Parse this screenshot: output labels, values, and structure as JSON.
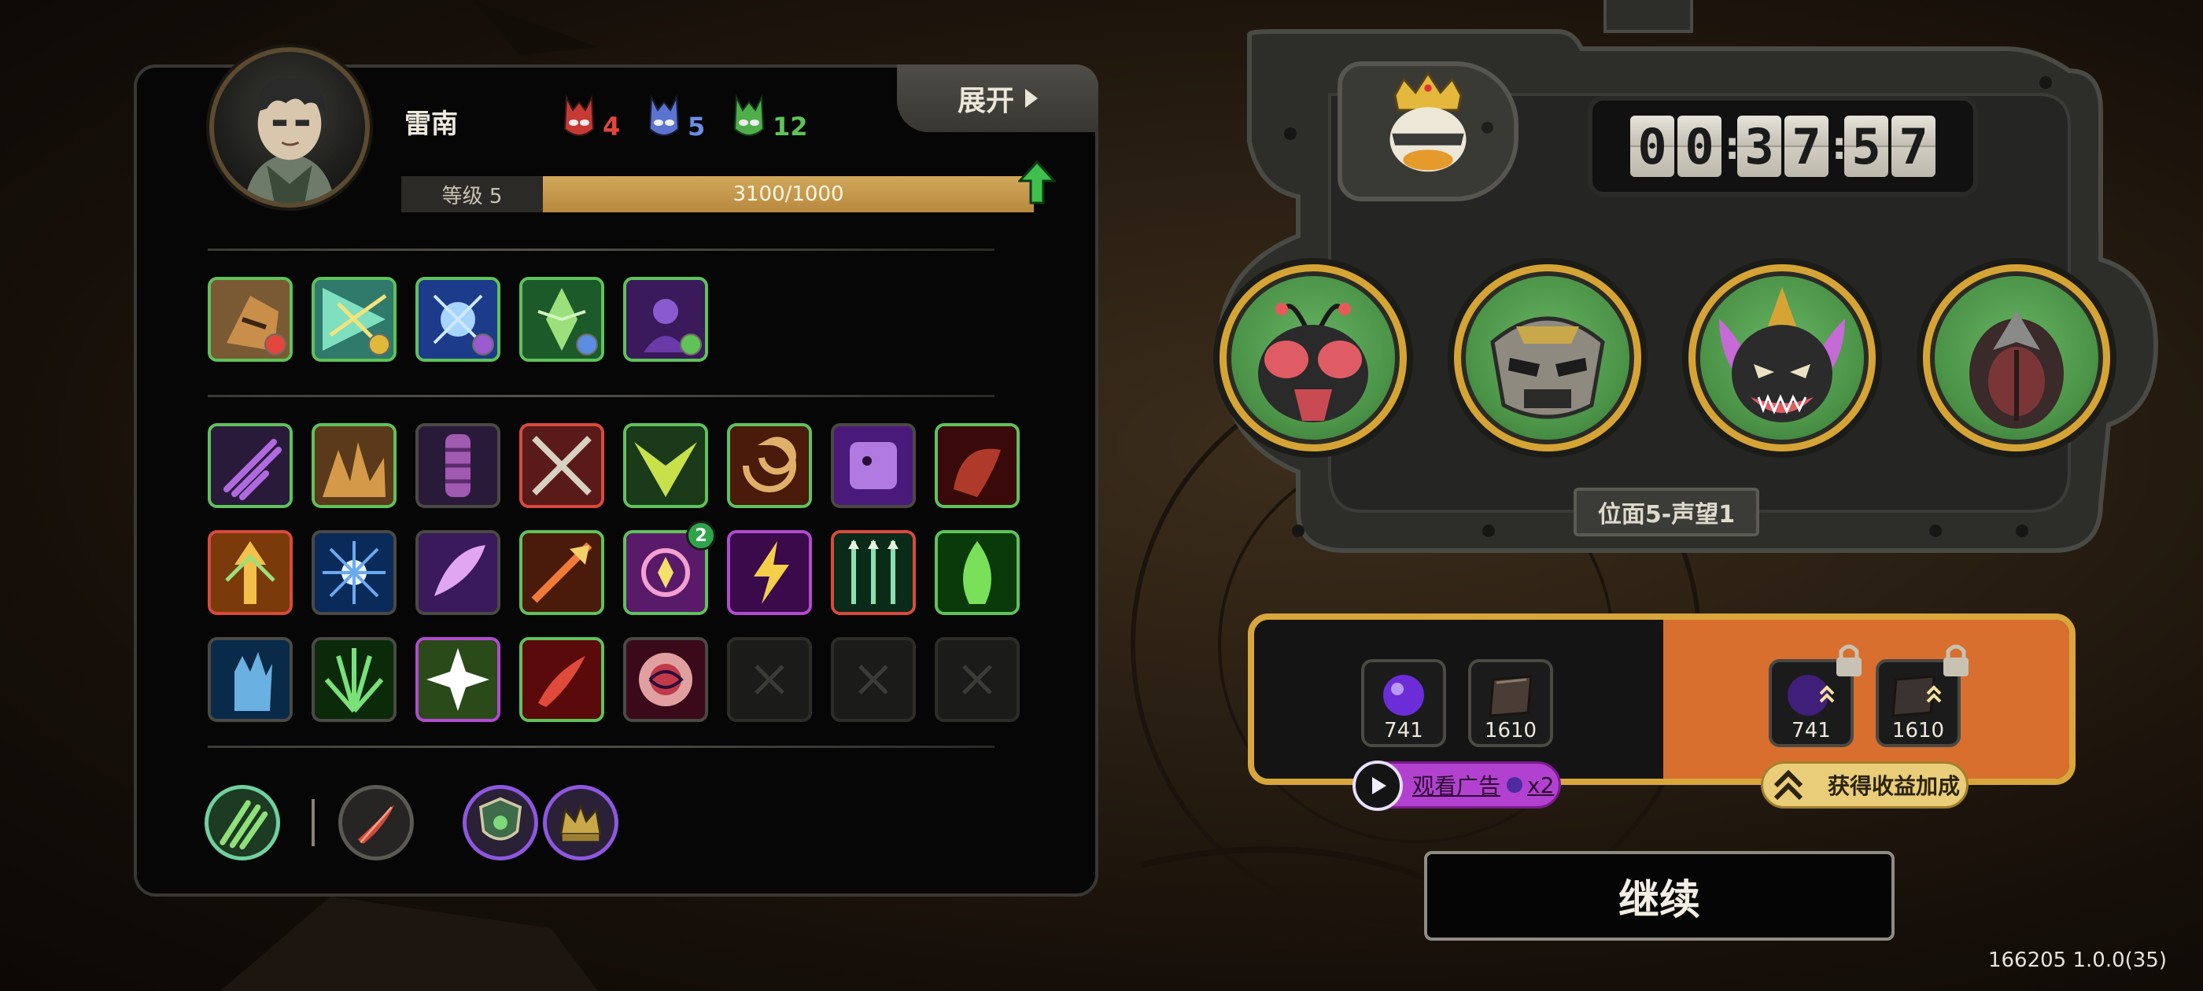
{
  "panel": {
    "expand_label": "展开",
    "character_name": "雷南",
    "gems": [
      {
        "color": "red",
        "count": "4",
        "hex": "#e2463d"
      },
      {
        "color": "blue",
        "count": "5",
        "hex": "#6c8de8"
      },
      {
        "color": "green",
        "count": "12",
        "hex": "#5fc25a"
      }
    ],
    "level_label": "等级 5",
    "xp_text": "3100/1000",
    "xp_progress": 1.0
  },
  "equipped_skills": [
    {
      "name": "rune-shield",
      "border": "#5fc25a",
      "badge": "red"
    },
    {
      "name": "light-burst",
      "border": "#5fc25a",
      "badge": "yellow"
    },
    {
      "name": "frost-orb",
      "border": "#5fc25a",
      "badge": "purple"
    },
    {
      "name": "nature-rune",
      "border": "#5fc25a",
      "badge": "blue"
    },
    {
      "name": "shadow-mage",
      "border": "#5fc25a",
      "badge": "green"
    }
  ],
  "skill_grid": {
    "borders": {
      "green": "#5fc25a",
      "red": "#d94a3c",
      "purple": "#b24ad0",
      "gray": "#4a4944"
    },
    "second_row_badge": "2"
  },
  "stage": {
    "timer_digits": [
      "0",
      "0",
      "3",
      "7",
      "5",
      "7"
    ],
    "position_label": "位面5-声望1"
  },
  "rewards": {
    "free": [
      {
        "icon": "purple-orb",
        "value": "741"
      },
      {
        "icon": "spellbook",
        "value": "1610"
      }
    ],
    "bonus": [
      {
        "icon": "purple-orb",
        "value": "741"
      },
      {
        "icon": "spellbook",
        "value": "1610"
      }
    ],
    "ad_label": "观看广告",
    "ad_multiplier": "x2",
    "bonus_label": "获得收益加成"
  },
  "continue_label": "继续",
  "version": "166205 1.0.0(35)",
  "colors": {
    "gold": "#d8a63a",
    "orange": "#d96f2e",
    "ad_purple": "#b341cf"
  }
}
